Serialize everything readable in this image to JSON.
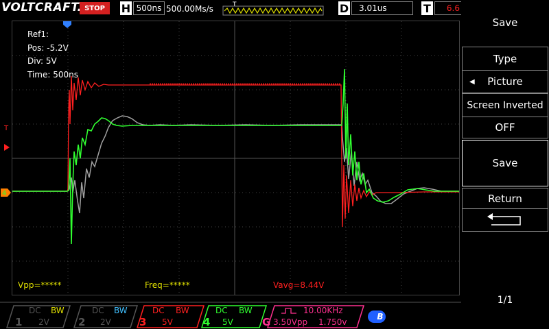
{
  "brand": "VOLTCRAFT.",
  "run_state": "STOP",
  "timebase": {
    "key": "H",
    "value": "500ns"
  },
  "sample_rate": "500.00Ms/s",
  "trigger_marker": "T",
  "delay": {
    "key": "D",
    "value": "3.01us"
  },
  "trigger_level": {
    "key": "T",
    "value": "6.6"
  },
  "ref_info": {
    "name": "Ref1:",
    "pos": "Pos: -5.2V",
    "div": "Div: 5V",
    "time": "Time: 500ns"
  },
  "measurements": {
    "vpp": "Vpp=*****",
    "freq": "Freq=*****",
    "vavg": "Vavg=8.44V"
  },
  "screen_markers": {
    "trigger_icon": "T",
    "channel4_marker": "4"
  },
  "menu": {
    "title": "Save",
    "type_label": "Type",
    "type_value": "Picture",
    "inverted_label": "Screen Inverted",
    "inverted_value": "OFF",
    "save_button": "Save",
    "return_label": "Return",
    "page": "1/1"
  },
  "channels": [
    {
      "num": "1",
      "coupling": "DC",
      "bw": "BW",
      "scale": "2V",
      "color": "#555555",
      "bw_color": "#e0e000"
    },
    {
      "num": "2",
      "coupling": "DC",
      "bw": "BW",
      "scale": "2V",
      "color": "#555555",
      "bw_color": "#40c0ff"
    },
    {
      "num": "3",
      "coupling": "DC",
      "bw": "BW",
      "scale": "5V",
      "color": "#ff2020",
      "bw_color": "#ff2020"
    },
    {
      "num": "4",
      "coupling": "DC",
      "bw": "BW",
      "scale": "5V",
      "color": "#30ff30",
      "bw_color": "#30ff30"
    }
  ],
  "generator": {
    "label": "G",
    "freq": "10.00KHz",
    "amp": "3.50Vpp",
    "offset": "1.750v",
    "color": "#ff3090"
  },
  "bluetooth_label": "B",
  "colors": {
    "ch3": "#ff2020",
    "ch4": "#30ff30",
    "ref": "#a0a0a0",
    "grid": "#444444",
    "trigger_orange": "#ff8000"
  }
}
